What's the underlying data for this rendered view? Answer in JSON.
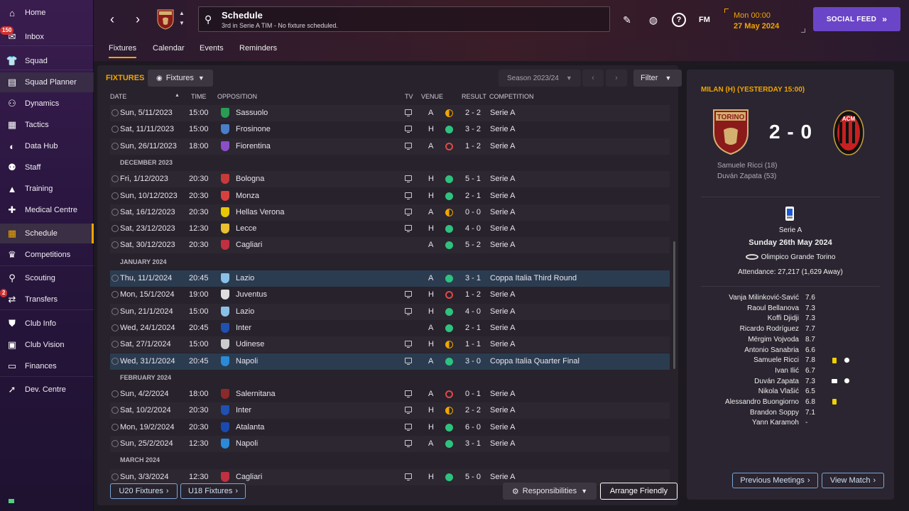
{
  "sidebar": {
    "items": [
      {
        "label": "Home",
        "icon": "home-icon"
      },
      {
        "label": "Inbox",
        "icon": "inbox-icon",
        "badge": "150"
      },
      {
        "label": "Squad",
        "icon": "shirt-icon"
      },
      {
        "label": "Squad Planner",
        "icon": "clipboard-icon"
      },
      {
        "label": "Dynamics",
        "icon": "people-icon"
      },
      {
        "label": "Tactics",
        "icon": "tactics-icon"
      },
      {
        "label": "Data Hub",
        "icon": "data-hub-icon"
      },
      {
        "label": "Staff",
        "icon": "staff-icon"
      },
      {
        "label": "Training",
        "icon": "training-icon"
      },
      {
        "label": "Medical Centre",
        "icon": "medical-icon"
      },
      {
        "label": "Schedule",
        "icon": "calendar-icon"
      },
      {
        "label": "Competitions",
        "icon": "trophy-icon"
      },
      {
        "label": "Scouting",
        "icon": "search-icon"
      },
      {
        "label": "Transfers",
        "icon": "transfer-icon",
        "badge": "2"
      },
      {
        "label": "Club Info",
        "icon": "shield-icon"
      },
      {
        "label": "Club Vision",
        "icon": "briefcase-icon"
      },
      {
        "label": "Finances",
        "icon": "money-icon"
      },
      {
        "label": "Dev. Centre",
        "icon": "dev-centre-icon"
      }
    ]
  },
  "header": {
    "title": "Schedule",
    "subtitle": "3rd in Serie A TIM - No fixture scheduled.",
    "date_line1": "Mon 00:00",
    "date_line2": "27 May 2024",
    "social_feed": "SOCIAL FEED",
    "fm_label": "FM"
  },
  "tabs": [
    "Fixtures",
    "Calendar",
    "Events",
    "Reminders"
  ],
  "fixtures": {
    "label": "FIXTURES",
    "view_dropdown": "Fixtures",
    "season": "Season 2023/24",
    "filter": "Filter",
    "columns": {
      "date": "DATE",
      "time": "TIME",
      "opposition": "OPPOSITION",
      "tv": "TV",
      "venue": "VENUE",
      "result": "RESULT",
      "competition": "COMPETITION"
    },
    "rows": [
      {
        "date": "Sun, 5/11/2023",
        "time": "15:00",
        "opp": "Sassuolo",
        "tv": true,
        "venue": "A",
        "outcome": "d",
        "score": "2 - 2",
        "comp": "Serie A",
        "badge": "#2a9d55"
      },
      {
        "date": "Sat, 11/11/2023",
        "time": "15:00",
        "opp": "Frosinone",
        "tv": true,
        "venue": "H",
        "outcome": "w",
        "score": "3 - 2",
        "comp": "Serie A",
        "badge": "#4a7ec8"
      },
      {
        "date": "Sun, 26/11/2023",
        "time": "18:00",
        "opp": "Fiorentina",
        "tv": true,
        "venue": "A",
        "outcome": "l",
        "score": "1 - 2",
        "comp": "Serie A",
        "badge": "#8a4ec8"
      },
      {
        "month": "DECEMBER 2023"
      },
      {
        "date": "Fri, 1/12/2023",
        "time": "20:30",
        "opp": "Bologna",
        "tv": true,
        "venue": "H",
        "outcome": "w",
        "score": "5 - 1",
        "comp": "Serie A",
        "badge": "#c83a3a"
      },
      {
        "date": "Sun, 10/12/2023",
        "time": "20:30",
        "opp": "Monza",
        "tv": true,
        "venue": "H",
        "outcome": "w",
        "score": "2 - 1",
        "comp": "Serie A",
        "badge": "#d84040"
      },
      {
        "date": "Sat, 16/12/2023",
        "time": "20:30",
        "opp": "Hellas Verona",
        "tv": true,
        "venue": "A",
        "outcome": "d",
        "score": "0 - 0",
        "comp": "Serie A",
        "badge": "#e8c800"
      },
      {
        "date": "Sat, 23/12/2023",
        "time": "12:30",
        "opp": "Lecce",
        "tv": true,
        "venue": "H",
        "outcome": "w",
        "score": "4 - 0",
        "comp": "Serie A",
        "badge": "#e8c030"
      },
      {
        "date": "Sat, 30/12/2023",
        "time": "20:30",
        "opp": "Cagliari",
        "tv": false,
        "venue": "A",
        "outcome": "w",
        "score": "5 - 2",
        "comp": "Serie A",
        "badge": "#c03040"
      },
      {
        "month": "JANUARY 2024"
      },
      {
        "date": "Thu, 11/1/2024",
        "time": "20:45",
        "opp": "Lazio",
        "tv": false,
        "venue": "A",
        "outcome": "w",
        "score": "3 - 1",
        "comp": "Coppa Italia Third Round",
        "badge": "#8ac0e8",
        "hl": true
      },
      {
        "date": "Mon, 15/1/2024",
        "time": "19:00",
        "opp": "Juventus",
        "tv": true,
        "venue": "H",
        "outcome": "l",
        "score": "1 - 2",
        "comp": "Serie A",
        "badge": "#dddddd"
      },
      {
        "date": "Sun, 21/1/2024",
        "time": "15:00",
        "opp": "Lazio",
        "tv": true,
        "venue": "H",
        "outcome": "w",
        "score": "4 - 0",
        "comp": "Serie A",
        "badge": "#8ac0e8"
      },
      {
        "date": "Wed, 24/1/2024",
        "time": "20:45",
        "opp": "Inter",
        "tv": false,
        "venue": "A",
        "outcome": "w",
        "score": "2 - 1",
        "comp": "Serie A",
        "badge": "#2050b0"
      },
      {
        "date": "Sat, 27/1/2024",
        "time": "15:00",
        "opp": "Udinese",
        "tv": true,
        "venue": "H",
        "outcome": "d",
        "score": "1 - 1",
        "comp": "Serie A",
        "badge": "#cccccc"
      },
      {
        "date": "Wed, 31/1/2024",
        "time": "20:45",
        "opp": "Napoli",
        "tv": true,
        "venue": "A",
        "outcome": "w",
        "score": "3 - 0",
        "comp": "Coppa Italia Quarter Final",
        "badge": "#2a8ad8",
        "hl": true
      },
      {
        "month": "FEBRUARY 2024"
      },
      {
        "date": "Sun, 4/2/2024",
        "time": "18:00",
        "opp": "Salernitana",
        "tv": true,
        "venue": "A",
        "outcome": "l",
        "score": "0 - 1",
        "comp": "Serie A",
        "badge": "#8a2a2a"
      },
      {
        "date": "Sat, 10/2/2024",
        "time": "20:30",
        "opp": "Inter",
        "tv": true,
        "venue": "H",
        "outcome": "d",
        "score": "2 - 2",
        "comp": "Serie A",
        "badge": "#2050b0"
      },
      {
        "date": "Mon, 19/2/2024",
        "time": "20:30",
        "opp": "Atalanta",
        "tv": true,
        "venue": "H",
        "outcome": "w",
        "score": "6 - 0",
        "comp": "Serie A",
        "badge": "#1a4ab0"
      },
      {
        "date": "Sun, 25/2/2024",
        "time": "12:30",
        "opp": "Napoli",
        "tv": true,
        "venue": "A",
        "outcome": "w",
        "score": "3 - 1",
        "comp": "Serie A",
        "badge": "#2a8ad8"
      },
      {
        "month": "MARCH 2024"
      },
      {
        "date": "Sun, 3/3/2024",
        "time": "12:30",
        "opp": "Cagliari",
        "tv": true,
        "venue": "H",
        "outcome": "w",
        "score": "5 - 0",
        "comp": "Serie A",
        "badge": "#c03040"
      }
    ],
    "u20": "U20 Fixtures",
    "u18": "U18 Fixtures",
    "responsibilities": "Responsibilities",
    "arrange_friendly": "Arrange Friendly"
  },
  "match": {
    "title": "MILAN (H) (YESTERDAY 15:00)",
    "score": "2 - 0",
    "home_crest_text": "TORINO",
    "away_crest_text": "ACM",
    "scorers": [
      "Samuele Ricci (18)",
      "Duván Zapata (53)"
    ],
    "competition": "Serie A",
    "date": "Sunday 26th May 2024",
    "stadium": "Olimpico Grande Torino",
    "attendance": "Attendance: 27,217 (1,629 Away)",
    "players": [
      {
        "name": "Vanja Milinković-Savić",
        "rating": "7.6"
      },
      {
        "name": "Raoul Bellanova",
        "rating": "7.3"
      },
      {
        "name": "Koffi Djidji",
        "rating": "7.3"
      },
      {
        "name": "Ricardo Rodríguez",
        "rating": "7.7"
      },
      {
        "name": "Mërgim Vojvoda",
        "rating": "8.7"
      },
      {
        "name": "Antonio Sanabria",
        "rating": "6.6"
      },
      {
        "name": "Samuele Ricci",
        "rating": "7.8"
      },
      {
        "name": "Ivan Ilić",
        "rating": "6.7"
      },
      {
        "name": "Duván Zapata",
        "rating": "7.3"
      },
      {
        "name": "Nikola Vlašić",
        "rating": "6.5"
      },
      {
        "name": "Alessandro Buongiorno",
        "rating": "6.8"
      },
      {
        "name": "Brandon Soppy",
        "rating": "7.1"
      },
      {
        "name": "Yann Karamoh",
        "rating": "-"
      }
    ],
    "previous_meetings": "Previous Meetings",
    "view_match": "View Match"
  },
  "colors": {
    "accent": "#f1a500",
    "social": "#6b45c8",
    "win": "#2ec27e",
    "loss": "#e04848"
  }
}
